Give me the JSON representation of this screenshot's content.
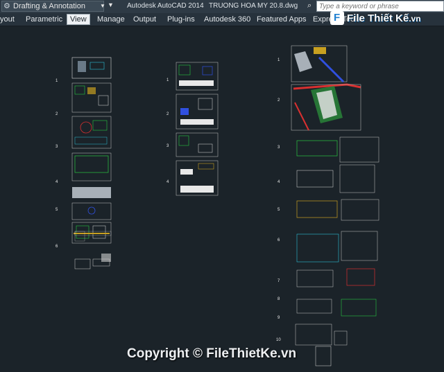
{
  "titlebar": {
    "workspace": "Drafting & Annotation",
    "app_title": "Autodesk AutoCAD 2014",
    "file_title": "TRUONG HOA MY 20.8.dwg",
    "search_placeholder": "Type a keyword or phrase"
  },
  "ribbon": {
    "tabs": [
      {
        "label": "yout"
      },
      {
        "label": "Parametric"
      },
      {
        "label": "View"
      },
      {
        "label": "Manage"
      },
      {
        "label": "Output"
      },
      {
        "label": "Plug-ins"
      },
      {
        "label": "Autodesk 360"
      },
      {
        "label": "Featured Apps"
      },
      {
        "label": "Express Tools"
      }
    ],
    "active_tab": "View"
  },
  "logo": {
    "letter": "F",
    "name": "File Thiết Kế",
    "suffix": ".vn"
  },
  "drawing": {
    "col1_numbers": [
      "1",
      "2",
      "3",
      "4",
      "5",
      "6"
    ],
    "col2_numbers": [
      "1",
      "2",
      "3",
      "4"
    ],
    "col3_numbers": [
      "1",
      "2",
      "3",
      "4",
      "5",
      "6",
      "7",
      "8",
      "9",
      "10"
    ]
  },
  "watermark": "Copyright © FileThietKe.vn",
  "colors": {
    "canvas": "#1b2329",
    "ribbon": "#27323c",
    "title": "#2e3a45",
    "accent": "#1e7fd0"
  }
}
